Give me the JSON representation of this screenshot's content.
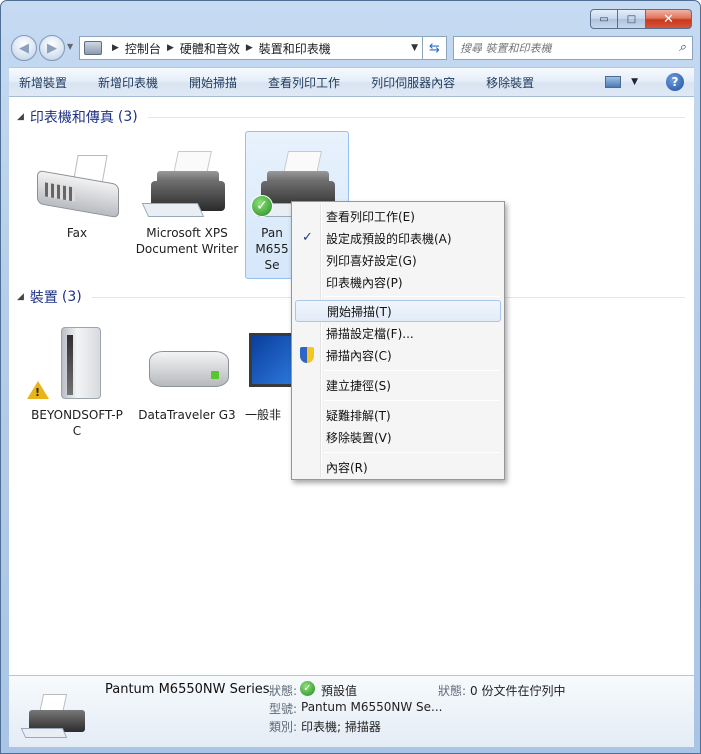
{
  "window": {
    "caption_buttons": {
      "minimize": "▭",
      "maximize": "□",
      "close": "✕"
    }
  },
  "nav": {
    "back_glyph": "◀",
    "forward_glyph": "▶",
    "breadcrumbs": [
      "控制台",
      "硬體和音效",
      "裝置和印表機"
    ],
    "search_placeholder": "搜尋 裝置和印表機"
  },
  "toolbar": {
    "items": [
      "新增裝置",
      "新增印表機",
      "開始掃描",
      "查看列印工作",
      "列印伺服器內容",
      "移除裝置"
    ],
    "help_label": "?"
  },
  "groups": {
    "printers": {
      "title": "印表機和傳真",
      "count": "(3)"
    },
    "devices": {
      "title": "裝置",
      "count": "(3)"
    }
  },
  "printers": [
    {
      "label": "Fax",
      "icon": "fax-icon"
    },
    {
      "label": "Microsoft XPS Document Writer",
      "icon": "printer-icon"
    },
    {
      "label": "Pantum M6550NW Series",
      "label_visible": "Pan M655 Se",
      "icon": "printer-icon",
      "default": true
    }
  ],
  "devices": [
    {
      "label": "BEYONDSOFT-PC",
      "label_line1": "BEYONDSOFT-P",
      "label_line2": "C",
      "icon": "computer-icon",
      "warning": true
    },
    {
      "label": "DataTraveler G3",
      "icon": "usb-drive-icon"
    },
    {
      "label": "一般非",
      "icon": "monitor-icon"
    }
  ],
  "context_menu": {
    "items": [
      {
        "label": "查看列印工作(E)"
      },
      {
        "label": "設定成預設的印表機(A)",
        "checked": true
      },
      {
        "label": "列印喜好設定(G)"
      },
      {
        "label": "印表機內容(P)"
      },
      {
        "label": "開始掃描(T)",
        "highlighted": true
      },
      {
        "label": "掃描設定檔(F)..."
      },
      {
        "label": "掃描內容(C)",
        "shield": true
      },
      {
        "label": "建立捷徑(S)"
      },
      {
        "label": "疑難排解(T)"
      },
      {
        "label": "移除裝置(V)"
      },
      {
        "label": "內容(R)"
      }
    ],
    "check_glyph": "✓"
  },
  "details": {
    "name": "Pantum M6550NW Series",
    "state_label": "狀態:",
    "state_value": "預設值",
    "model_label": "型號:",
    "model_value": "Pantum M6550NW Se...",
    "category_label": "類別:",
    "category_value": "印表機; 掃描器",
    "status_label": "狀態:",
    "status_value": "0 份文件在佇列中"
  },
  "colors": {
    "group_title": "#1e3287",
    "selection_border": "#99c1ee",
    "default_check": "#1e8a1e"
  }
}
